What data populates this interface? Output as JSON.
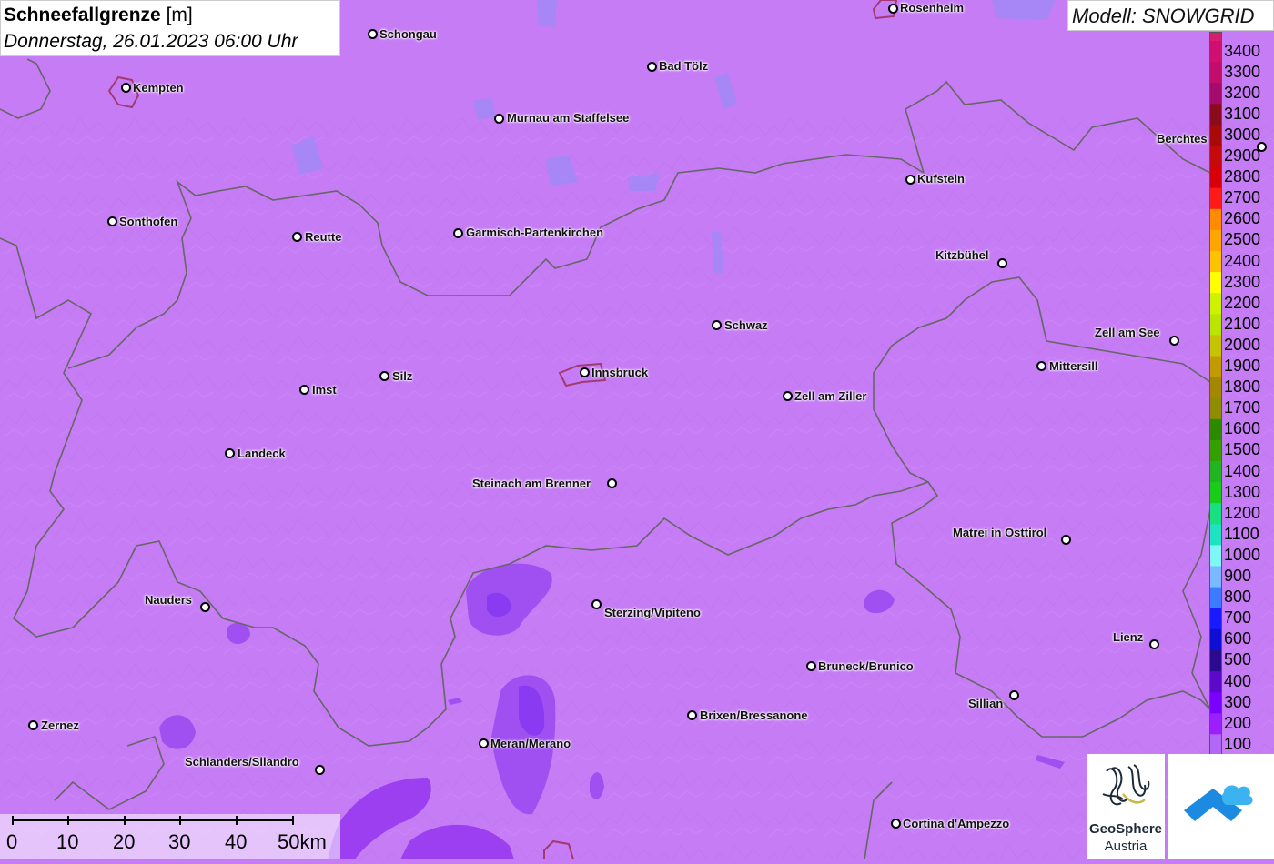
{
  "title": {
    "main": "Schneefallgrenze",
    "unit": "[m]",
    "datetime": "Donnerstag, 26.01.2023 06:00 Uhr"
  },
  "model": "Modell: SNOWGRID",
  "cities": [
    {
      "name": "Rosenheim"
    },
    {
      "name": "Schongau"
    },
    {
      "name": "Bad Tölz"
    },
    {
      "name": "Kempten"
    },
    {
      "name": "Murnau am Staffelsee"
    },
    {
      "name": "Berchtes"
    },
    {
      "name": "Kufstein"
    },
    {
      "name": "Sonthofen"
    },
    {
      "name": "Reutte"
    },
    {
      "name": "Garmisch-Partenkirchen"
    },
    {
      "name": "Kitzbühel"
    },
    {
      "name": "Schwaz"
    },
    {
      "name": "Zell am See"
    },
    {
      "name": "Silz"
    },
    {
      "name": "Innsbruck"
    },
    {
      "name": "Mittersill"
    },
    {
      "name": "Imst"
    },
    {
      "name": "Zell am Ziller"
    },
    {
      "name": "Landeck"
    },
    {
      "name": "Steinach am Brenner"
    },
    {
      "name": "Matrei in Osttirol"
    },
    {
      "name": "Nauders"
    },
    {
      "name": "Sterzing/Vipiteno"
    },
    {
      "name": "Lienz"
    },
    {
      "name": "Bruneck/Brunico"
    },
    {
      "name": "Sillian"
    },
    {
      "name": "Brixen/Bressanone"
    },
    {
      "name": "Zernez"
    },
    {
      "name": "Meran/Merano"
    },
    {
      "name": "Schlanders/Silandro"
    },
    {
      "name": "Cortina d'Ampezzo"
    }
  ],
  "legend": {
    "labels": [
      "3400",
      "3300",
      "3200",
      "3100",
      "3000",
      "2900",
      "2800",
      "2700",
      "2600",
      "2500",
      "2400",
      "2300",
      "2200",
      "2100",
      "2000",
      "1900",
      "1800",
      "1700",
      "1600",
      "1500",
      "1400",
      "1300",
      "1200",
      "1100",
      "1000",
      "900",
      "800",
      "700",
      "600",
      "500",
      "400",
      "300",
      "200",
      "100"
    ],
    "colors": [
      "#d10f6e",
      "#c20d6a",
      "#a40b6a",
      "#8a0b1c",
      "#a80a0a",
      "#c40a0a",
      "#d6000a",
      "#ff1a1a",
      "#ff8c00",
      "#ffa500",
      "#ffc200",
      "#ffff00",
      "#ccf200",
      "#b8e600",
      "#c6c400",
      "#c29b00",
      "#a38700",
      "#8e8c00",
      "#2b8a00",
      "#33a000",
      "#22b422",
      "#18cc18",
      "#18e080",
      "#1de3c0",
      "#7ef7f5",
      "#7ab8ff",
      "#3a7bff",
      "#1a1aff",
      "#0e0ed4",
      "#2a0b8f",
      "#5a0ac8",
      "#7a00ff",
      "#9b1fff",
      "#b367f7"
    ]
  },
  "scale": {
    "ticks": [
      "0",
      "10",
      "20",
      "30",
      "40",
      "50km"
    ]
  },
  "logos": {
    "geosphere_name": "GeoSphere",
    "geosphere_sub": "Austria"
  }
}
